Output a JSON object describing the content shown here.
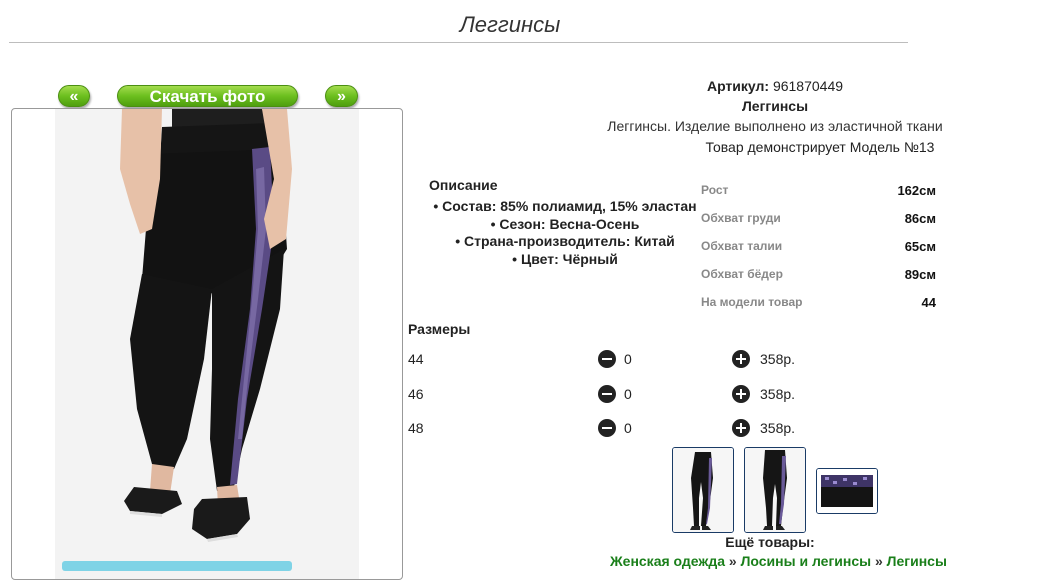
{
  "page": {
    "title": "Леггинсы"
  },
  "gallery": {
    "prev_label": "«",
    "download_label": "Скачать фото",
    "next_label": "»"
  },
  "product": {
    "article_label": "Артикул:",
    "article_value": "961870449",
    "name": "Леггинсы",
    "short_description": "Леггинсы. Изделие выполнено из эластичной ткани",
    "model_line": "Товар демонстрирует Модель №13"
  },
  "description": {
    "title": "Описание",
    "items": [
      "• Состав: 85% полиамид, 15% эластан",
      "• Сезон: Весна-Осень",
      "• Страна-производитель: Китай",
      "• Цвет: Чёрный"
    ]
  },
  "measurements": [
    {
      "label": "Рост",
      "value": "162см"
    },
    {
      "label": "Обхват груди",
      "value": "86см"
    },
    {
      "label": "Обхват талии",
      "value": "65см"
    },
    {
      "label": "Обхват бёдер",
      "value": "89см"
    },
    {
      "label": "На модели товар",
      "value": "44"
    }
  ],
  "sizes": {
    "title": "Размеры",
    "rows": [
      {
        "size": "44",
        "qty": "0",
        "price": "358р."
      },
      {
        "size": "46",
        "qty": "0",
        "price": "358р."
      },
      {
        "size": "48",
        "qty": "0",
        "price": "358р."
      }
    ]
  },
  "more": {
    "title": "Ещё товары:",
    "breadcrumb": [
      "Женская одежда",
      "Лосины и легинсы",
      "Легинсы"
    ],
    "separator": "»"
  },
  "colors": {
    "green_button": "#6cbf1f",
    "link_green": "#1a7f1a",
    "thumb_border": "#1a3b66"
  }
}
